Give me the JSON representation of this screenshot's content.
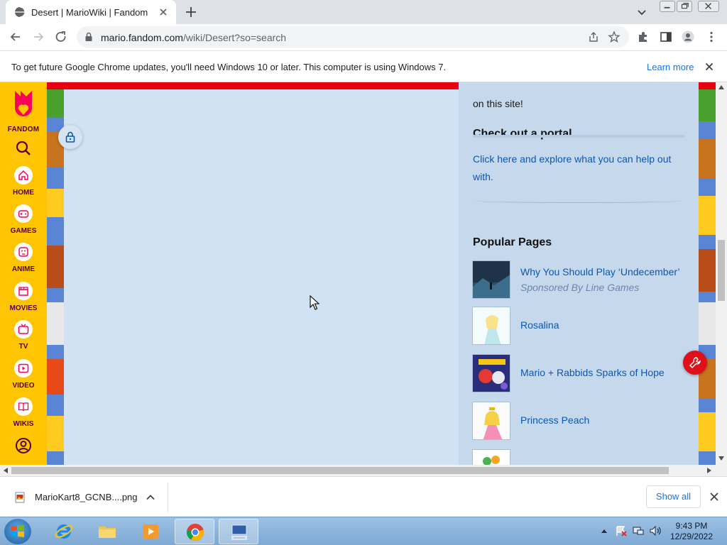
{
  "browser": {
    "tab_title": "Desert | MarioWiki | Fandom",
    "url_domain": "mario.fandom.com",
    "url_path": "/wiki/Desert?so=search"
  },
  "infobar": {
    "message": "To get future Google Chrome updates, you'll need Windows 10 or later. This computer is using Windows 7.",
    "learn_more": "Learn more"
  },
  "fandom_rail": {
    "logo_label": "FANDOM",
    "items": [
      {
        "label": "HOME",
        "icon": "home-icon"
      },
      {
        "label": "GAMES",
        "icon": "gamepad-icon"
      },
      {
        "label": "ANIME",
        "icon": "anime-icon"
      },
      {
        "label": "MOVIES",
        "icon": "clapperboard-icon"
      },
      {
        "label": "TV",
        "icon": "tv-icon"
      },
      {
        "label": "VIDEO",
        "icon": "video-play-icon"
      },
      {
        "label": "WIKIS",
        "icon": "book-icon"
      }
    ],
    "accent": "#ffc500",
    "label_color": "#520044"
  },
  "sidebar": {
    "intro_tail": "on this site!",
    "portal": {
      "heading": "Check out a portal",
      "link": "Click here and explore what you can help out with."
    },
    "popular": {
      "heading": "Popular Pages",
      "items": [
        {
          "title": "Why You Should Play ‘Undecember’",
          "sponsor": "Sponsored By Line Games"
        },
        {
          "title": "Rosalina"
        },
        {
          "title": "Mario + Rabbids Sparks of Hope"
        },
        {
          "title": "Princess Peach"
        }
      ]
    }
  },
  "downloads": {
    "file_name": "MarioKart8_GCNB....png",
    "show_all": "Show all"
  },
  "taskbar": {
    "time": "9:43 PM",
    "date": "12/29/2022"
  },
  "colors": {
    "page_bg": "#d0e2f4",
    "sidebar_bg": "#c6d9ec",
    "link": "#0b56b3",
    "red_banner": "#e60012"
  }
}
